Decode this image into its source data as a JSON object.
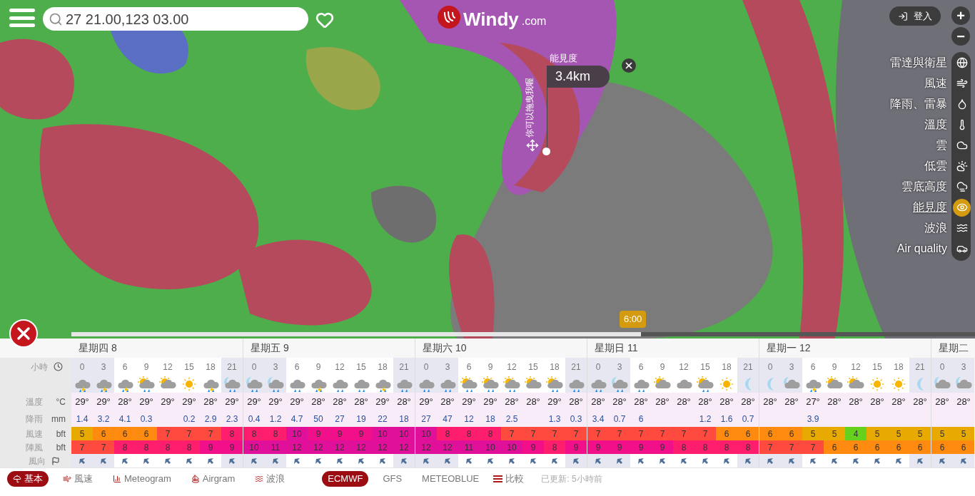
{
  "search": {
    "value": "27 21.00,123 03.00"
  },
  "logo": {
    "name": "Windy",
    "suffix": ".com"
  },
  "login": {
    "label": "登入"
  },
  "zoom": {
    "plus": "+",
    "minus": "−"
  },
  "picker": {
    "label": "能見度",
    "value": "3.4km",
    "hint": "你可以拖曳我喔"
  },
  "layers": [
    {
      "label": "雷達與衛星",
      "selected": false
    },
    {
      "label": "風速",
      "selected": false
    },
    {
      "label": "降雨、雷暴",
      "selected": false
    },
    {
      "label": "溫度",
      "selected": false
    },
    {
      "label": "雲",
      "selected": false
    },
    {
      "label": "低雲",
      "selected": false
    },
    {
      "label": "雲底高度",
      "selected": false
    },
    {
      "label": "能見度",
      "selected": true
    },
    {
      "label": "波浪",
      "selected": false
    },
    {
      "label": "Air quality",
      "selected": false
    }
  ],
  "timeline": {
    "level": 0.63,
    "time": "6:00"
  },
  "table": {
    "row_labels": {
      "hour": "小時",
      "temp": {
        "label": "溫度",
        "unit": "°C"
      },
      "rain": {
        "label": "降雨",
        "unit": "mm"
      },
      "wind": {
        "label": "風速",
        "unit": "bft"
      },
      "gust": {
        "label": "陣風",
        "unit": "bft"
      },
      "direction": "風向"
    },
    "days": [
      {
        "label": "星期四 8",
        "hours": [
          {
            "hour": "0",
            "kind": "storm",
            "night": true,
            "temp": "29°",
            "rain": "1.4",
            "wind": "5",
            "gust": "7"
          },
          {
            "hour": "3",
            "kind": "storm",
            "night": true,
            "temp": "29°",
            "rain": "3.2",
            "wind": "6",
            "gust": "7"
          },
          {
            "hour": "6",
            "kind": "storm",
            "night": false,
            "temp": "28°",
            "rain": "4.1",
            "wind": "6",
            "gust": "8"
          },
          {
            "hour": "9",
            "kind": "sun-rain",
            "night": false,
            "temp": "29°",
            "rain": "0.3",
            "wind": "6",
            "gust": "8"
          },
          {
            "hour": "12",
            "kind": "sun-cloud",
            "night": false,
            "temp": "29°",
            "wind": "7",
            "gust": "8"
          },
          {
            "hour": "15",
            "kind": "sun",
            "night": false,
            "temp": "29°",
            "rain": "0.2",
            "wind": "7",
            "gust": "8"
          },
          {
            "hour": "18",
            "kind": "storm",
            "night": false,
            "temp": "28°",
            "rain": "2.9",
            "wind": "7",
            "gust": "9"
          },
          {
            "hour": "21",
            "kind": "moon-rain",
            "night": true,
            "temp": "29°",
            "rain": "2.3",
            "wind": "8",
            "gust": "9"
          }
        ]
      },
      {
        "label": "星期五 9",
        "hours": [
          {
            "hour": "0",
            "kind": "moon-rain",
            "night": true,
            "temp": "29°",
            "rain": "0.4",
            "wind": "8",
            "gust": "10"
          },
          {
            "hour": "3",
            "kind": "moon-rain",
            "night": true,
            "temp": "29°",
            "rain": "1.2",
            "wind": "8",
            "gust": "11"
          },
          {
            "hour": "6",
            "kind": "rain",
            "night": false,
            "temp": "29°",
            "rain": "4.7",
            "wind": "10",
            "gust": "12"
          },
          {
            "hour": "9",
            "kind": "storm",
            "night": false,
            "temp": "28°",
            "rain": "50",
            "wind": "9",
            "gust": "12"
          },
          {
            "hour": "12",
            "kind": "rain",
            "night": false,
            "temp": "28°",
            "rain": "27",
            "wind": "9",
            "gust": "12"
          },
          {
            "hour": "15",
            "kind": "rain",
            "night": false,
            "temp": "28°",
            "rain": "19",
            "wind": "9",
            "gust": "12"
          },
          {
            "hour": "18",
            "kind": "storm",
            "night": false,
            "temp": "29°",
            "rain": "22",
            "wind": "10",
            "gust": "12"
          },
          {
            "hour": "21",
            "kind": "rain",
            "night": true,
            "temp": "28°",
            "rain": "18",
            "wind": "10",
            "gust": "12"
          }
        ]
      },
      {
        "label": "星期六 10",
        "hours": [
          {
            "hour": "0",
            "kind": "rain",
            "night": true,
            "temp": "29°",
            "rain": "27",
            "wind": "10",
            "gust": "12"
          },
          {
            "hour": "3",
            "kind": "rain",
            "night": true,
            "temp": "28°",
            "rain": "47",
            "wind": "8",
            "gust": "12"
          },
          {
            "hour": "6",
            "kind": "sun-rain",
            "night": false,
            "temp": "29°",
            "rain": "12",
            "wind": "8",
            "gust": "11"
          },
          {
            "hour": "9",
            "kind": "sun-rain",
            "night": false,
            "temp": "29°",
            "rain": "18",
            "wind": "8",
            "gust": "10"
          },
          {
            "hour": "12",
            "kind": "sun-rain",
            "night": false,
            "temp": "28°",
            "rain": "2.5",
            "wind": "7",
            "gust": "10"
          },
          {
            "hour": "15",
            "kind": "sun-cloud",
            "night": false,
            "temp": "28°",
            "wind": "7",
            "gust": "9"
          },
          {
            "hour": "18",
            "kind": "sun-rain",
            "night": false,
            "temp": "29°",
            "rain": "1.3",
            "wind": "7",
            "gust": "8"
          },
          {
            "hour": "21",
            "kind": "rain",
            "night": true,
            "temp": "28°",
            "rain": "0.3",
            "wind": "7",
            "gust": "9"
          }
        ]
      },
      {
        "label": "星期日 11",
        "hours": [
          {
            "hour": "0",
            "kind": "rain",
            "night": true,
            "temp": "28°",
            "rain": "3.4",
            "wind": "7",
            "gust": "9"
          },
          {
            "hour": "3",
            "kind": "moon-rain",
            "night": true,
            "temp": "28°",
            "rain": "0.7",
            "wind": "7",
            "gust": "9"
          },
          {
            "hour": "6",
            "kind": "rain",
            "night": false,
            "temp": "28°",
            "rain": "6",
            "wind": "7",
            "gust": "9"
          },
          {
            "hour": "9",
            "kind": "sun-cloud",
            "night": false,
            "temp": "28°",
            "wind": "7",
            "gust": "9"
          },
          {
            "hour": "12",
            "kind": "cloud",
            "night": false,
            "temp": "28°",
            "wind": "7",
            "gust": "8"
          },
          {
            "hour": "15",
            "kind": "sun-rain",
            "night": false,
            "temp": "28°",
            "rain": "1.2",
            "wind": "7",
            "gust": "8"
          },
          {
            "hour": "18",
            "kind": "sun",
            "night": false,
            "temp": "28°",
            "rain": "1.6",
            "wind": "6",
            "gust": "8"
          },
          {
            "hour": "21",
            "kind": "moon",
            "night": true,
            "temp": "28°",
            "rain": "0.7",
            "wind": "6",
            "gust": "8"
          }
        ]
      },
      {
        "label": "星期一 12",
        "hours": [
          {
            "hour": "0",
            "kind": "moon",
            "night": true,
            "temp": "28°",
            "wind": "6",
            "gust": "7"
          },
          {
            "hour": "3",
            "kind": "moon-cloud",
            "night": true,
            "temp": "28°",
            "wind": "6",
            "gust": "7"
          },
          {
            "hour": "6",
            "kind": "storm",
            "night": false,
            "temp": "27°",
            "rain": "3.9",
            "wind": "5",
            "gust": "7"
          },
          {
            "hour": "9",
            "kind": "sun-cloud",
            "night": false,
            "temp": "28°",
            "wind": "5",
            "gust": "6"
          },
          {
            "hour": "12",
            "kind": "sun-cloud",
            "night": false,
            "temp": "28°",
            "wind": "4",
            "gust": "6"
          },
          {
            "hour": "15",
            "kind": "sun",
            "night": false,
            "temp": "28°",
            "wind": "5",
            "gust": "6"
          },
          {
            "hour": "18",
            "kind": "sun",
            "night": false,
            "temp": "28°",
            "wind": "5",
            "gust": "6"
          },
          {
            "hour": "21",
            "kind": "moon",
            "night": true,
            "temp": "28°",
            "wind": "5",
            "gust": "6"
          }
        ]
      },
      {
        "label": "星期二",
        "hours": [
          {
            "hour": "0",
            "kind": "moon-cloud",
            "night": true,
            "temp": "28°",
            "wind": "5",
            "gust": "6"
          },
          {
            "hour": "3",
            "kind": "moon-cloud",
            "night": true,
            "temp": "28°",
            "wind": "5",
            "gust": "6"
          }
        ]
      }
    ]
  },
  "views": [
    {
      "label": "基本",
      "selected": true
    },
    {
      "label": "風速",
      "selected": false
    },
    {
      "label": "Meteogram",
      "selected": false
    },
    {
      "label": "Airgram",
      "selected": false
    },
    {
      "label": "波浪",
      "selected": false
    }
  ],
  "models": [
    {
      "label": "ECMWF",
      "selected": true
    },
    {
      "label": "GFS",
      "selected": false
    },
    {
      "label": "METEOBLUE",
      "selected": false
    }
  ],
  "compare": "比較",
  "updated": "已更新: 5小時前"
}
